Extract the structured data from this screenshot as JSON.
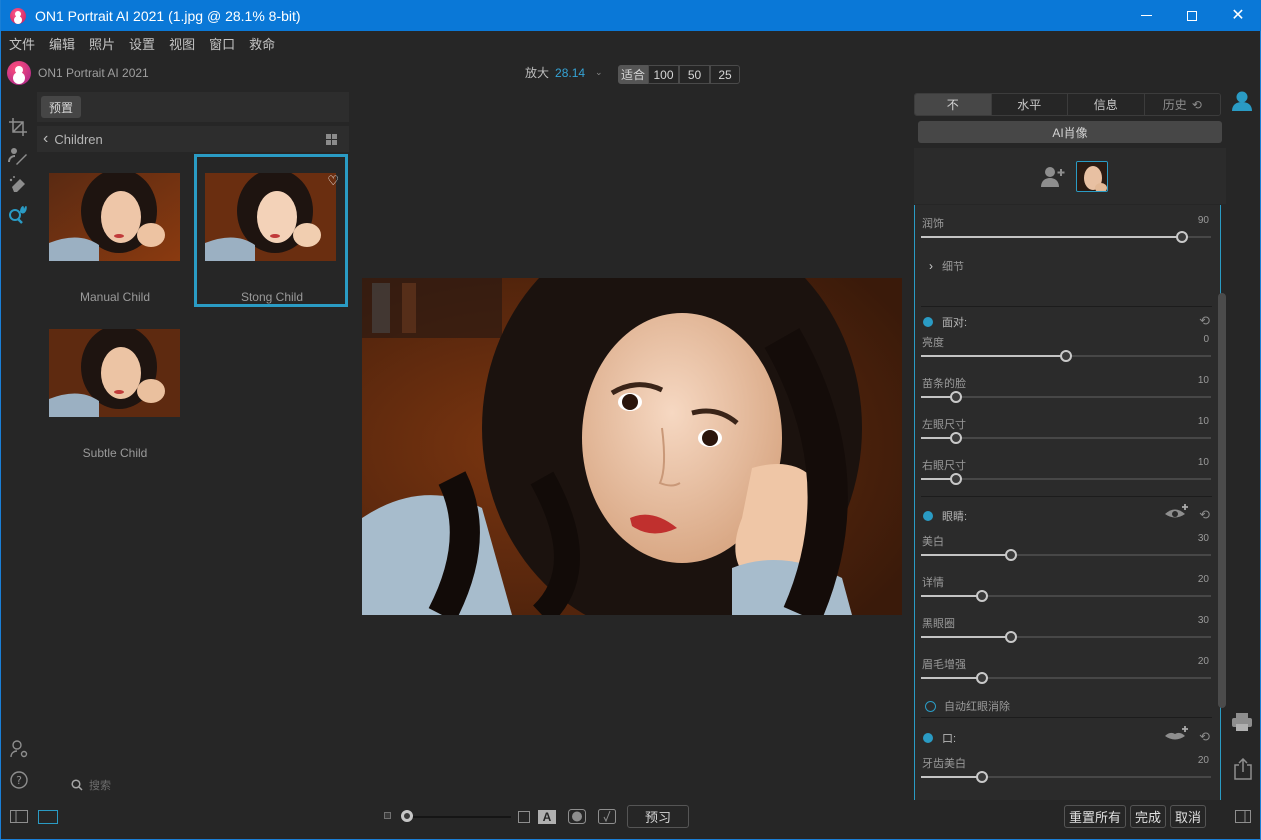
{
  "window": {
    "title": "ON1 Portrait AI 2021 (1.jpg @ 28.1% 8-bit)",
    "controls": {
      "minimize": "minimize",
      "maximize": "maximize",
      "close": "✕"
    }
  },
  "menu": [
    "文件",
    "编辑",
    "照片",
    "设置",
    "视图",
    "窗口",
    "救命"
  ],
  "brand": {
    "name": "ON1 Portrait AI 2021"
  },
  "zoom": {
    "label": "放大",
    "value": "28.14",
    "buttons": [
      "适合",
      "100",
      "50",
      "25"
    ],
    "active": "适合"
  },
  "browse": {
    "presets_label": "预置",
    "folder": "Children",
    "presets": [
      {
        "label": "Manual Child",
        "selected": false
      },
      {
        "label": "Stong Child",
        "selected": true,
        "favorite": true
      },
      {
        "label": "Subtle Child",
        "selected": false
      }
    ],
    "search_placeholder": "搜索"
  },
  "right_panel": {
    "tabs": [
      "不",
      "水平",
      "信息",
      "历史"
    ],
    "active_tab": "不",
    "ai_button": "AI肖像",
    "smooth": {
      "label": "润饰",
      "value": 90,
      "percent": 90
    },
    "detail_label": "细节",
    "face": {
      "title": "面对:",
      "sliders": [
        {
          "label": "亮度",
          "value": 0,
          "percent": 50
        },
        {
          "label": "苗条的脸",
          "value": 10,
          "percent": 12
        },
        {
          "label": "左眼尺寸",
          "value": 10,
          "percent": 12
        },
        {
          "label": "右眼尺寸",
          "value": 10,
          "percent": 12
        }
      ]
    },
    "eyes": {
      "title": "眼睛:",
      "sliders": [
        {
          "label": "美白",
          "value": 30,
          "percent": 31
        },
        {
          "label": "详情",
          "value": 20,
          "percent": 21
        },
        {
          "label": "黑眼圈",
          "value": 30,
          "percent": 31
        },
        {
          "label": "眉毛增强",
          "value": 20,
          "percent": 21
        }
      ],
      "redeye_label": "自动红眼消除"
    },
    "mouth": {
      "title": "口:",
      "sliders": [
        {
          "label": "牙齿美白",
          "value": 20,
          "percent": 21
        }
      ]
    }
  },
  "bottom": {
    "preview_label": "预习",
    "view_a_label": "A",
    "reset_all": "重置所有",
    "done": "完成",
    "cancel": "取消"
  },
  "colors": {
    "accent": "#2a9bc4",
    "titlebar": "#0a78d7",
    "background": "#262626"
  }
}
